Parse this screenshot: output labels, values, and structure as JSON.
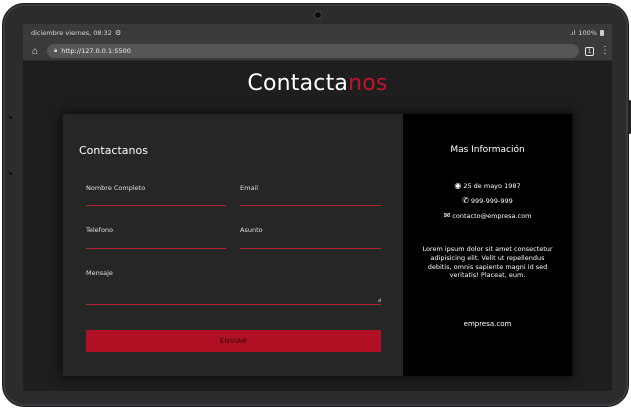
{
  "statusbar": {
    "datetime": "diciembre viernes, 08:32",
    "gear_icon": "⚙",
    "signal": ".ıl",
    "battery_text": "100%"
  },
  "browser": {
    "url": "http://127.0.0.1:5500",
    "tab_count": "1"
  },
  "page": {
    "title_main": "Contacta",
    "title_accent": "nos",
    "accent_color": "#c0142a"
  },
  "form": {
    "title": "Contactanos",
    "fields": {
      "name": "Nombre Completo",
      "email": "Email",
      "phone": "Telefono",
      "subject": "Asunto",
      "message": "Mensaje"
    },
    "submit_label": "ENVIAR"
  },
  "info": {
    "title": "Mas Información",
    "date": "25 de mayo 1987",
    "phone": "999-999-999",
    "email": "contacto@empresa.com",
    "description": "Lorem ipsum dolor sit amet consectetur adipisicing elit. Velit ut repellendus debitis, omnis sapiente magni id sed veritatis! Placeat, eum.",
    "website": "empresa.com"
  }
}
